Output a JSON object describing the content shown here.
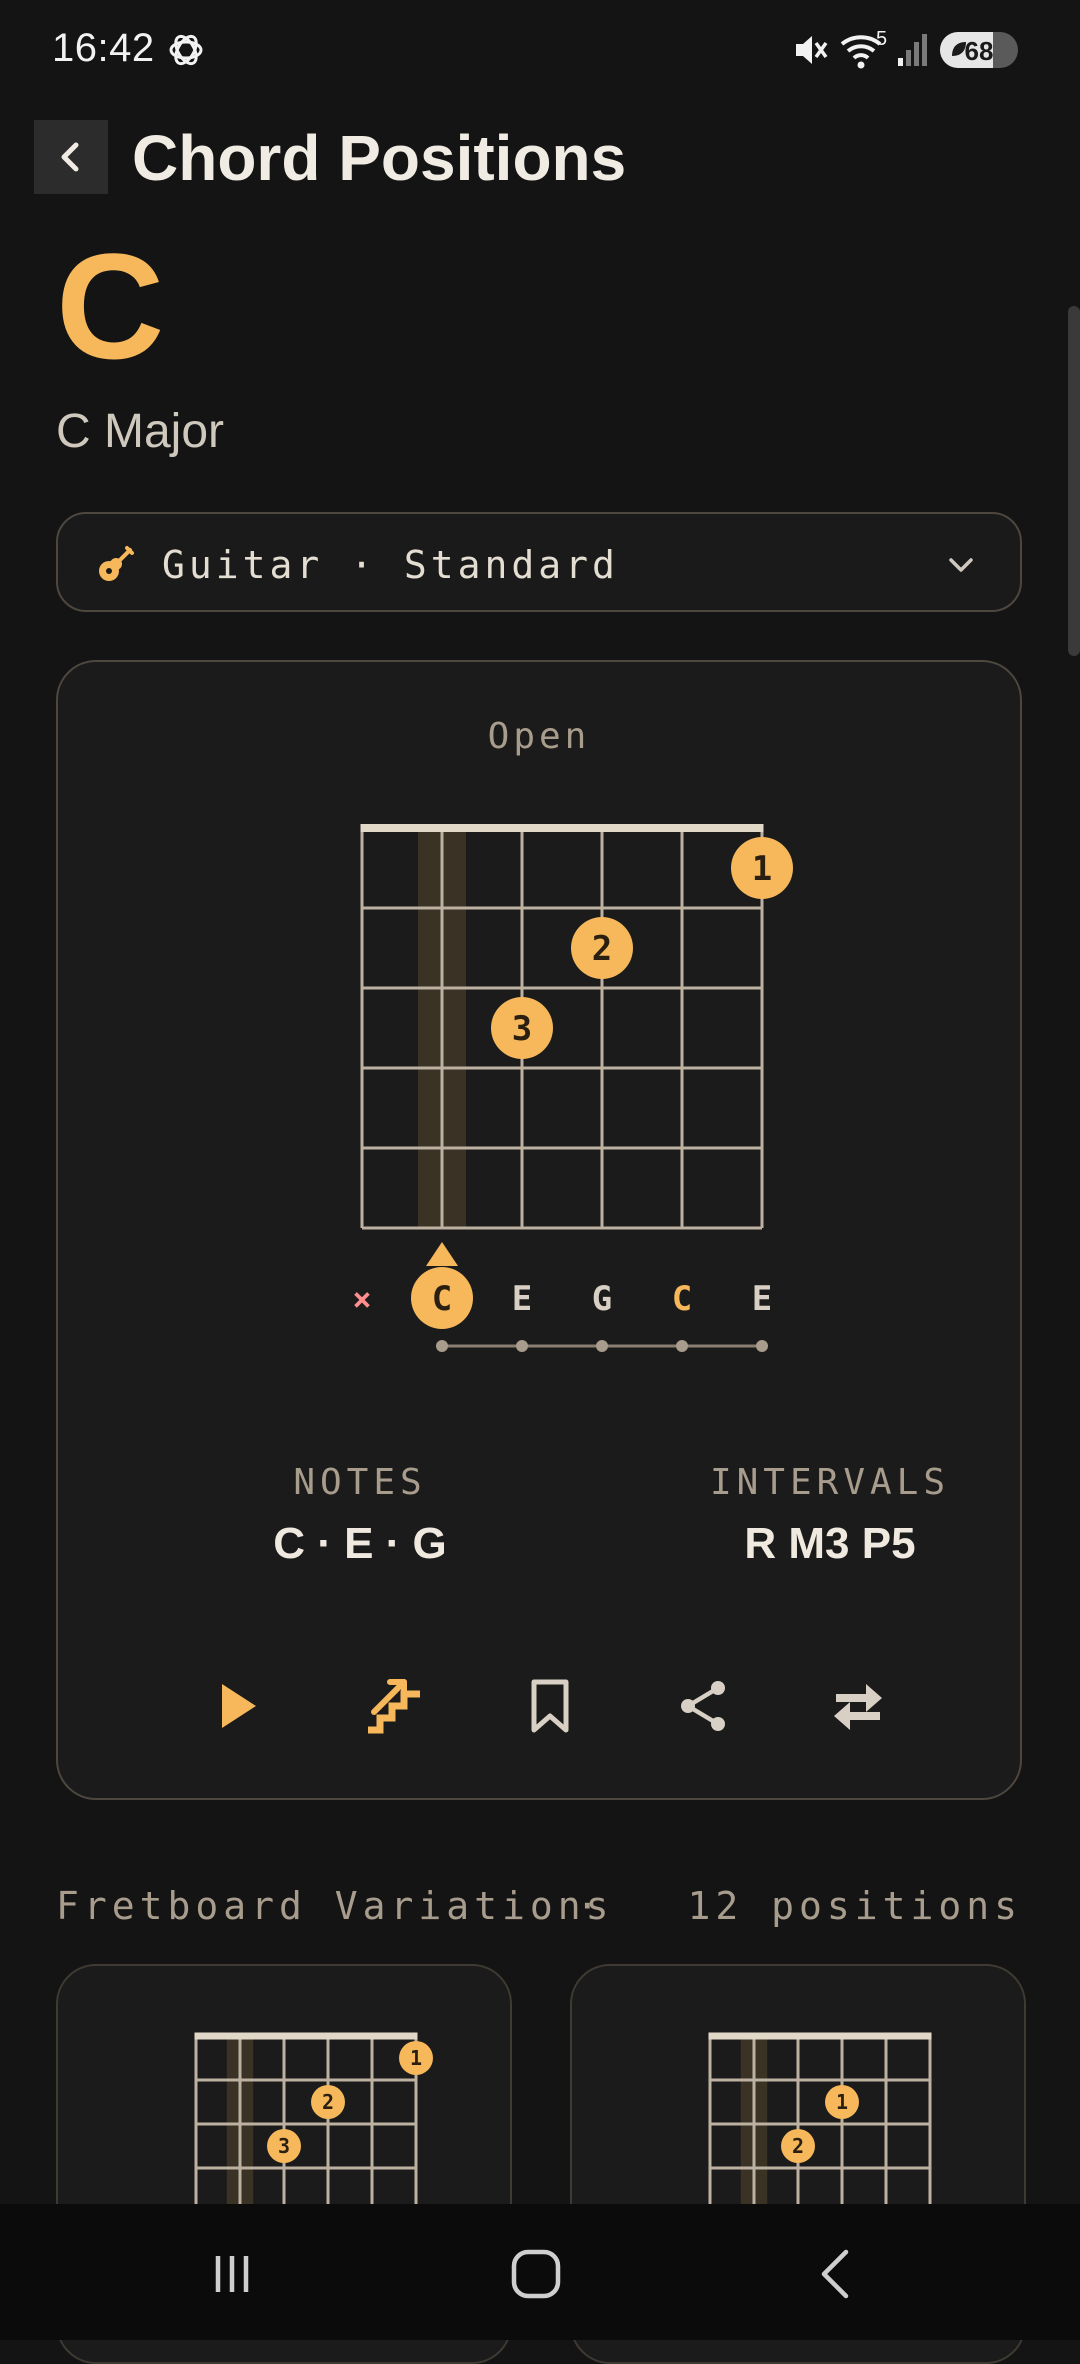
{
  "status": {
    "time": "16:42",
    "battery": "68",
    "battery_level": 0.68,
    "wifi_badge": "5"
  },
  "header": {
    "title": "Chord Positions"
  },
  "chord": {
    "symbol": "C",
    "name": "C Major"
  },
  "instrument": {
    "label": "Guitar · Standard"
  },
  "voicing": {
    "title": "Open",
    "strings": 6,
    "frets": 5,
    "root_string": 1,
    "markers": [
      {
        "string": 1,
        "value": "×",
        "type": "mute"
      },
      {
        "string": 2,
        "value": "C",
        "type": "root"
      },
      {
        "string": 3,
        "value": "E",
        "type": "note"
      },
      {
        "string": 4,
        "value": "G",
        "type": "note"
      },
      {
        "string": 5,
        "value": "C",
        "type": "octave"
      },
      {
        "string": 6,
        "value": "E",
        "type": "note"
      }
    ],
    "fingers": [
      {
        "string": 5,
        "fret": 1,
        "label": "1"
      },
      {
        "string": 3,
        "fret": 2,
        "label": "2"
      },
      {
        "string": 2,
        "fret": 3,
        "label": "3"
      }
    ]
  },
  "info": {
    "notes_label": "NOTES",
    "notes_value": "C · E · G",
    "intervals_label": "INTERVALS",
    "intervals_value": "R M3 P5"
  },
  "actions": [
    {
      "name": "play-icon",
      "color": "#f6b85a"
    },
    {
      "name": "arpeggio-icon",
      "color": "#f6b85a"
    },
    {
      "name": "bookmark-icon",
      "color": "#d8d0c4"
    },
    {
      "name": "share-icon",
      "color": "#d8d0c4"
    },
    {
      "name": "swap-icon",
      "color": "#d8d0c4"
    }
  ],
  "variations": {
    "title": "Fretboard Variations",
    "separator": "·",
    "count": "12 positions",
    "items": [
      {
        "fingers": [
          {
            "string": 5,
            "fret": 1,
            "label": "1"
          },
          {
            "string": 3,
            "fret": 2,
            "label": "2"
          },
          {
            "string": 2,
            "fret": 3,
            "label": "3"
          }
        ],
        "root_string": 1
      },
      {
        "fingers": [
          {
            "string": 3,
            "fret": 2,
            "label": "1"
          },
          {
            "string": 2,
            "fret": 3,
            "label": "2"
          }
        ],
        "root_string": 1
      }
    ]
  },
  "colors": {
    "accent": "#f6b85a",
    "grid": "#bdb2a2",
    "muted": "#ff8f8f",
    "bg": "#141414"
  }
}
